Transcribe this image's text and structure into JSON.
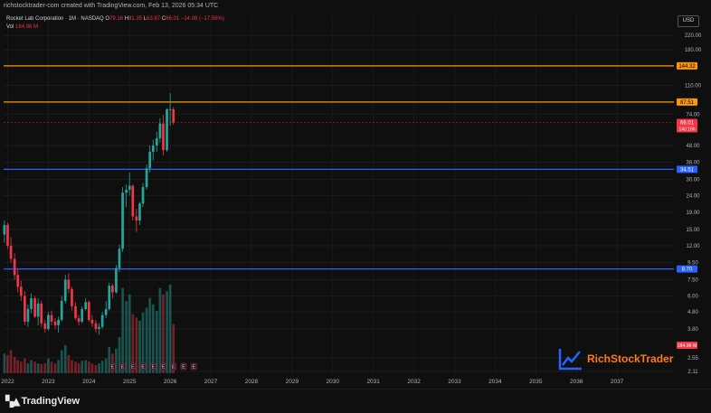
{
  "header": {
    "created_text": "richstocktrader-com created with TradingView.com, Feb 13, 2026 05:34 UTC"
  },
  "legend": {
    "symbol": "Rocket Lab Corporation · 1M · NASDAQ",
    "o_label": "O",
    "o": "79.16",
    "h_label": "H",
    "h": "81.35",
    "l_label": "L",
    "l": "63.87",
    "c_label": "C",
    "c": "66.01",
    "change": "−14.06 (−17.56%)",
    "vol_label": "Vol",
    "vol": "184.96 M"
  },
  "currency_button": "USD",
  "footer": {
    "brand": "TradingView"
  },
  "watermark": {
    "text": "RichStockTrader"
  },
  "colors": {
    "up": "#26a69a",
    "down": "#f23645",
    "orange": "#ff9800",
    "blue": "#2962ff",
    "bg": "#0f0f0f"
  },
  "chart_data": {
    "type": "candlestick",
    "symbol": "RKLB",
    "interval": "1M",
    "y_scale": "log",
    "ylim": [
      2.11,
      290
    ],
    "y_ticks": [
      2.11,
      2.55,
      3.8,
      4.8,
      6.0,
      7.5,
      9.5,
      12.0,
      15.0,
      19.0,
      24.0,
      30.0,
      38.0,
      48.0,
      74.0,
      110.0,
      180.0,
      220.0
    ],
    "y_tick_labels": [
      "2.11",
      "2.55",
      "3.80",
      "4.80",
      "6.00",
      "7.50",
      "9.50",
      "12.00",
      "15.00",
      "19.00",
      "24.00",
      "30.00",
      "38.00",
      "48.00",
      "74.00",
      "110.00",
      "180.00",
      "220.00"
    ],
    "x_labels": [
      "2022",
      "2023",
      "2024",
      "2025",
      "2026",
      "2027",
      "2028",
      "2029",
      "2030",
      "2031",
      "2032",
      "2033",
      "2034",
      "2035",
      "2036",
      "2037"
    ],
    "x_range": [
      2021.9,
      2038.4
    ],
    "candles": [
      {
        "t": 2021.92,
        "o": 14.0,
        "h": 17.0,
        "l": 12.5,
        "c": 16.0
      },
      {
        "t": 2022.0,
        "o": 16.0,
        "h": 16.5,
        "l": 11.5,
        "c": 12.0
      },
      {
        "t": 2022.08,
        "o": 12.0,
        "h": 13.5,
        "l": 9.5,
        "c": 10.0
      },
      {
        "t": 2022.17,
        "o": 10.0,
        "h": 10.8,
        "l": 7.5,
        "c": 8.0
      },
      {
        "t": 2022.25,
        "o": 8.0,
        "h": 8.6,
        "l": 6.3,
        "c": 6.8
      },
      {
        "t": 2022.33,
        "o": 6.8,
        "h": 7.4,
        "l": 5.6,
        "c": 6.0
      },
      {
        "t": 2022.42,
        "o": 6.0,
        "h": 6.4,
        "l": 4.0,
        "c": 4.2
      },
      {
        "t": 2022.5,
        "o": 4.2,
        "h": 5.3,
        "l": 3.9,
        "c": 5.0
      },
      {
        "t": 2022.58,
        "o": 5.0,
        "h": 6.2,
        "l": 4.7,
        "c": 5.8
      },
      {
        "t": 2022.67,
        "o": 5.8,
        "h": 6.0,
        "l": 4.4,
        "c": 4.5
      },
      {
        "t": 2022.75,
        "o": 4.5,
        "h": 5.8,
        "l": 4.0,
        "c": 5.4
      },
      {
        "t": 2022.83,
        "o": 5.4,
        "h": 5.6,
        "l": 3.9,
        "c": 4.1
      },
      {
        "t": 2022.92,
        "o": 4.1,
        "h": 4.3,
        "l": 3.6,
        "c": 3.8
      },
      {
        "t": 2023.0,
        "o": 3.8,
        "h": 4.8,
        "l": 3.7,
        "c": 4.6
      },
      {
        "t": 2023.08,
        "o": 4.6,
        "h": 4.9,
        "l": 4.0,
        "c": 4.2
      },
      {
        "t": 2023.17,
        "o": 4.2,
        "h": 4.4,
        "l": 3.8,
        "c": 4.0
      },
      {
        "t": 2023.25,
        "o": 4.0,
        "h": 4.5,
        "l": 3.6,
        "c": 4.3
      },
      {
        "t": 2023.33,
        "o": 4.3,
        "h": 6.0,
        "l": 4.2,
        "c": 5.6
      },
      {
        "t": 2023.42,
        "o": 5.6,
        "h": 8.0,
        "l": 5.4,
        "c": 7.5
      },
      {
        "t": 2023.5,
        "o": 7.5,
        "h": 8.2,
        "l": 6.2,
        "c": 6.6
      },
      {
        "t": 2023.58,
        "o": 6.6,
        "h": 6.8,
        "l": 4.9,
        "c": 5.2
      },
      {
        "t": 2023.67,
        "o": 5.2,
        "h": 5.5,
        "l": 4.3,
        "c": 4.4
      },
      {
        "t": 2023.75,
        "o": 4.4,
        "h": 4.6,
        "l": 4.0,
        "c": 4.2
      },
      {
        "t": 2023.83,
        "o": 4.2,
        "h": 5.2,
        "l": 4.1,
        "c": 5.0
      },
      {
        "t": 2023.92,
        "o": 5.0,
        "h": 5.8,
        "l": 4.9,
        "c": 5.5
      },
      {
        "t": 2024.0,
        "o": 5.5,
        "h": 5.6,
        "l": 4.2,
        "c": 4.3
      },
      {
        "t": 2024.08,
        "o": 4.3,
        "h": 4.6,
        "l": 3.9,
        "c": 4.1
      },
      {
        "t": 2024.17,
        "o": 4.1,
        "h": 4.3,
        "l": 3.6,
        "c": 3.8
      },
      {
        "t": 2024.25,
        "o": 3.8,
        "h": 4.1,
        "l": 3.5,
        "c": 3.9
      },
      {
        "t": 2024.33,
        "o": 3.9,
        "h": 4.8,
        "l": 3.8,
        "c": 4.6
      },
      {
        "t": 2024.42,
        "o": 4.6,
        "h": 5.6,
        "l": 4.4,
        "c": 5.0
      },
      {
        "t": 2024.5,
        "o": 5.0,
        "h": 7.2,
        "l": 4.9,
        "c": 6.9
      },
      {
        "t": 2024.58,
        "o": 6.9,
        "h": 7.1,
        "l": 5.8,
        "c": 6.3
      },
      {
        "t": 2024.67,
        "o": 6.3,
        "h": 9.2,
        "l": 6.2,
        "c": 8.8
      },
      {
        "t": 2024.75,
        "o": 8.8,
        "h": 12.2,
        "l": 8.3,
        "c": 11.5
      },
      {
        "t": 2024.83,
        "o": 11.5,
        "h": 27.0,
        "l": 11.0,
        "c": 25.0
      },
      {
        "t": 2024.92,
        "o": 25.0,
        "h": 28.0,
        "l": 20.5,
        "c": 26.0
      },
      {
        "t": 2025.0,
        "o": 26.0,
        "h": 33.0,
        "l": 24.0,
        "c": 27.5
      },
      {
        "t": 2025.08,
        "o": 27.5,
        "h": 28.0,
        "l": 17.0,
        "c": 18.0
      },
      {
        "t": 2025.17,
        "o": 18.0,
        "h": 20.0,
        "l": 14.5,
        "c": 17.0
      },
      {
        "t": 2025.25,
        "o": 17.0,
        "h": 22.0,
        "l": 16.0,
        "c": 21.5
      },
      {
        "t": 2025.33,
        "o": 21.5,
        "h": 28.5,
        "l": 20.5,
        "c": 27.0
      },
      {
        "t": 2025.42,
        "o": 27.0,
        "h": 37.0,
        "l": 26.0,
        "c": 35.0
      },
      {
        "t": 2025.5,
        "o": 35.0,
        "h": 48.0,
        "l": 33.0,
        "c": 44.0
      },
      {
        "t": 2025.58,
        "o": 44.0,
        "h": 52.0,
        "l": 39.0,
        "c": 48.0
      },
      {
        "t": 2025.67,
        "o": 48.0,
        "h": 58.0,
        "l": 44.0,
        "c": 53.0
      },
      {
        "t": 2025.75,
        "o": 53.0,
        "h": 70.0,
        "l": 50.0,
        "c": 65.0
      },
      {
        "t": 2025.83,
        "o": 65.0,
        "h": 73.0,
        "l": 42.0,
        "c": 45.0
      },
      {
        "t": 2025.92,
        "o": 45.0,
        "h": 80.0,
        "l": 44.0,
        "c": 79.16
      },
      {
        "t": 2026.0,
        "o": 79.16,
        "h": 99.0,
        "l": 63.0,
        "c": 79.16
      },
      {
        "t": 2026.08,
        "o": 79.16,
        "h": 81.35,
        "l": 63.87,
        "c": 66.01
      }
    ],
    "volume_unit": "M",
    "volumes": [
      60,
      55,
      70,
      50,
      40,
      35,
      45,
      30,
      40,
      35,
      30,
      28,
      30,
      45,
      35,
      30,
      40,
      70,
      85,
      55,
      40,
      35,
      30,
      38,
      40,
      35,
      30,
      25,
      30,
      38,
      45,
      80,
      60,
      75,
      110,
      260,
      220,
      240,
      180,
      170,
      160,
      185,
      200,
      230,
      210,
      190,
      260,
      240,
      250,
      270,
      150
    ],
    "horizontal_levels": [
      {
        "value": 144.32,
        "label": "144.32",
        "color": "#ff9800"
      },
      {
        "value": 87.51,
        "label": "87.51",
        "color": "#ff9800"
      },
      {
        "value": 34.51,
        "label": "34.51",
        "color": "#2962ff"
      },
      {
        "value": 8.7,
        "label": "8.70",
        "color": "#2962ff"
      }
    ],
    "last_price": {
      "value": 66.01,
      "label": "66.01",
      "countdown": "14d 16h"
    },
    "volume_label": "184.96 M",
    "earnings_markers": [
      "E",
      "E",
      "E",
      "E",
      "E",
      "E",
      "E",
      "E",
      "E"
    ]
  }
}
